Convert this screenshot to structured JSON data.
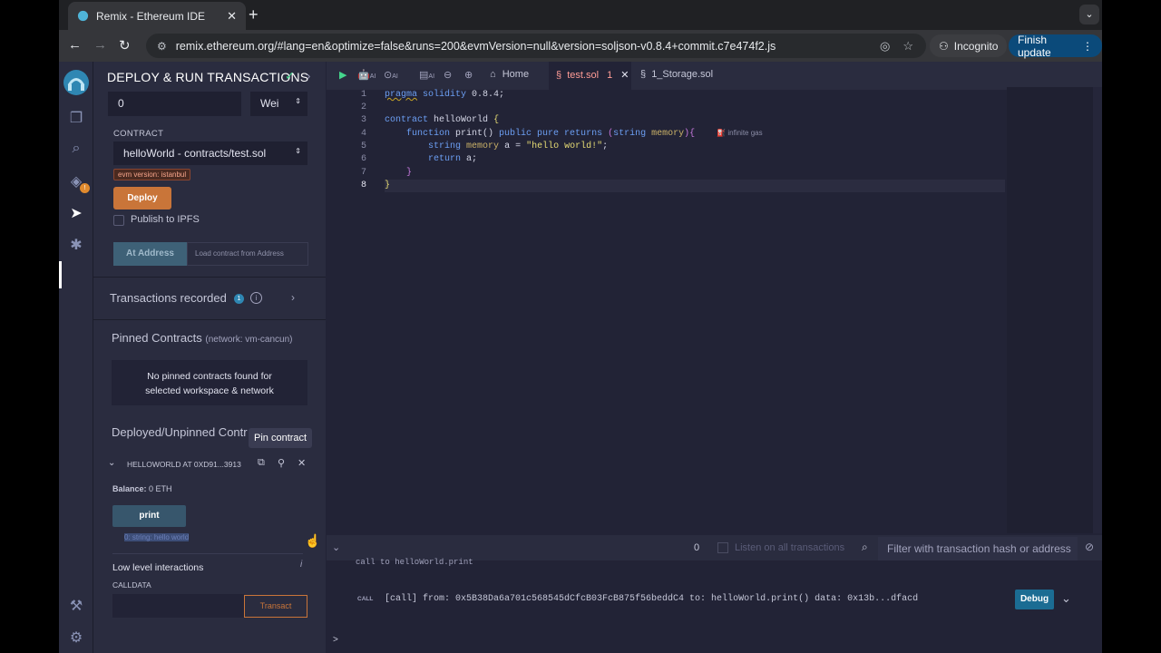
{
  "browser": {
    "tab_title": "Remix - Ethereum IDE",
    "url": "remix.ethereum.org/#lang=en&optimize=false&runs=200&evmVersion=null&version=soljson-v0.8.4+commit.c7e474f2.js",
    "incognito_label": "Incognito",
    "finish_update_label": "Finish update"
  },
  "panel": {
    "title": "DEPLOY & RUN TRANSACTIONS",
    "value_amount": "0",
    "value_unit": "Wei",
    "contract_label": "CONTRACT",
    "contract_selected": "helloWorld - contracts/test.sol",
    "evm_badge": "evm version: istanbul",
    "deploy_label": "Deploy",
    "publish_ipfs_label": "Publish to IPFS",
    "at_address_label": "At Address",
    "at_address_placeholder": "Load contract from Address",
    "transactions_recorded": "Transactions recorded",
    "transactions_count": "1",
    "pinned_title": "Pinned Contracts",
    "pinned_network": "(network: vm-cancun)",
    "no_pinned_line1": "No pinned contracts found for",
    "no_pinned_line2": "selected workspace & network",
    "deployed_title": "Deployed/Unpinned Contr",
    "tooltip": "Pin contract",
    "instance_name": "HELLOWORLD AT 0XD91...3913",
    "balance_label": "Balance:",
    "balance_value": "0 ETH",
    "print_label": "print",
    "return_text": "0: string: hello world",
    "low_level_label": "Low level interactions",
    "calldata_label": "CALLDATA",
    "transact_label": "Transact"
  },
  "editor": {
    "home_tab": "Home",
    "active_tab": "test.sol",
    "active_tab_errors": "1",
    "other_tab": "1_Storage.sol",
    "line_numbers": [
      "1",
      "2",
      "3",
      "4",
      "5",
      "6",
      "7",
      "8"
    ],
    "gas_hint": "infinite gas",
    "ai_label": "AI"
  },
  "terminal": {
    "count": "0",
    "listen_label": "Listen on all transactions",
    "filter_placeholder": "Filter with transaction hash or address",
    "cut_text": "call to helloWorld.print",
    "call_tag": "CALL",
    "call_line": "[call] from: 0x5B38Da6a701c568545dCfcB03FcB875f56beddC4 to: helloWorld.print() data: 0x13b...dfacd",
    "debug_label": "Debug",
    "prompt": ">"
  },
  "colors": {
    "accent_deploy": "#c97539",
    "accent_blue": "#1b6c93",
    "active_tab_error": "#ff9c96"
  }
}
